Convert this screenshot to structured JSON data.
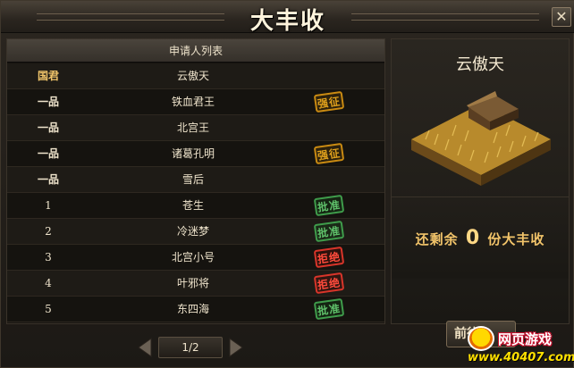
{
  "window": {
    "title": "大丰收",
    "close_label": "✕"
  },
  "applicant_list": {
    "header": "申请人列表",
    "rows": [
      {
        "rank": "国君",
        "name": "云傲天",
        "stamp": ""
      },
      {
        "rank": "一品",
        "name": "铁血君王",
        "stamp": "强征"
      },
      {
        "rank": "一品",
        "name": "北宫王",
        "stamp": ""
      },
      {
        "rank": "一品",
        "name": "诸葛孔明",
        "stamp": "强征"
      },
      {
        "rank": "一品",
        "name": "雪后",
        "stamp": ""
      },
      {
        "rank": "1",
        "name": "苍生",
        "stamp": "批准"
      },
      {
        "rank": "2",
        "name": "冷迷梦",
        "stamp": "批准"
      },
      {
        "rank": "3",
        "name": "北宫小号",
        "stamp": "拒绝"
      },
      {
        "rank": "4",
        "name": "叶邪将",
        "stamp": "拒绝"
      },
      {
        "rank": "5",
        "name": "东四海",
        "stamp": "批准"
      }
    ]
  },
  "pager": {
    "page": "1/2"
  },
  "owner": {
    "name": "云傲天",
    "remain_prefix": "还剩余",
    "remain_count": "0",
    "remain_suffix": "份大丰收"
  },
  "go_button": {
    "label": "前往"
  },
  "watermark": {
    "site_name": "网页游戏",
    "url": "www.40407.com"
  },
  "colors": {
    "gold": "#f1c56a",
    "stamp_force": "#e0a11c",
    "stamp_approve": "#5fc06a",
    "stamp_reject": "#ff4b3c"
  }
}
